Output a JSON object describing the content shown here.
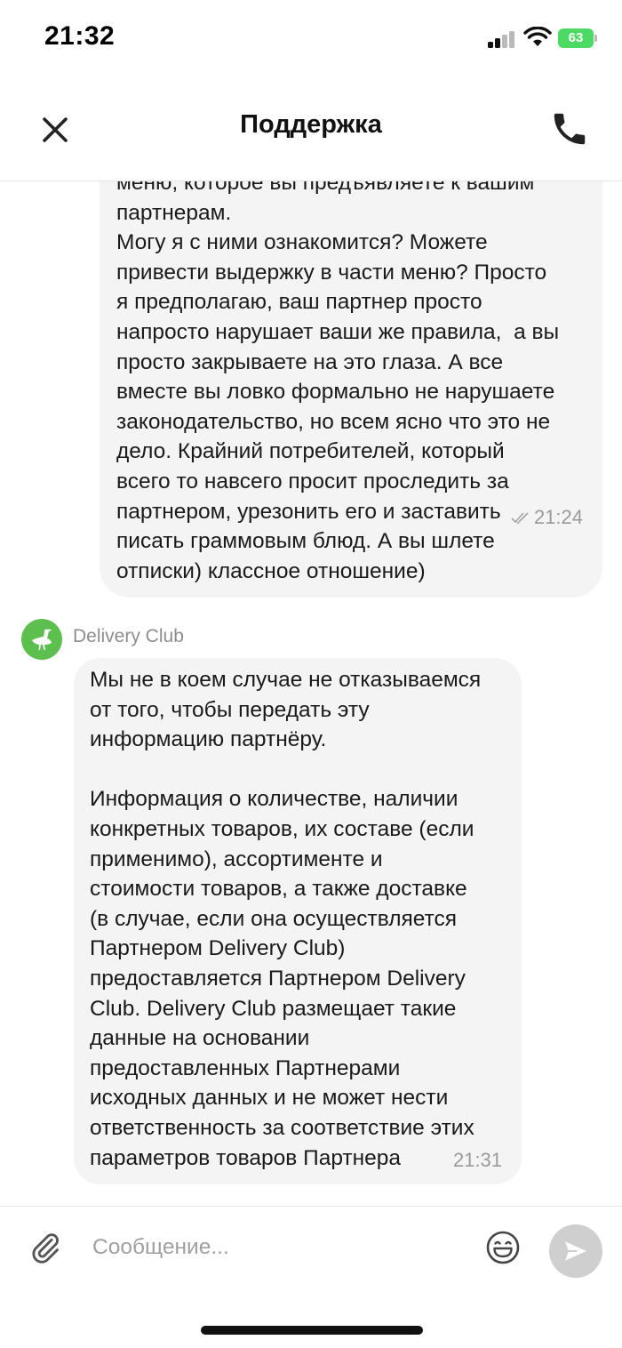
{
  "status_bar": {
    "time": "21:32",
    "battery": "63"
  },
  "header": {
    "title": "Поддержка",
    "close_icon": "close-icon",
    "call_icon": "phone-icon"
  },
  "chat": {
    "messages": [
      {
        "direction": "outgoing",
        "text": "меню, которое вы предъявляете к вашим\nпартнерам.\nМогу я с ними ознакомится? Можете\nпривести выдержку в части меню? Просто\nя предполагаю, ваш партнер просто\nнапросто нарушает ваши же правила,  а вы\nпросто закрываете на это глаза. А все\nвместе вы ловко формально не нарушаете\nзаконодательство, но всем ясно что это не\nдело. Крайний потребителей, который\nвсего то навсего просит проследить за\nпартнером, урезонить его и заставить\nписать граммовым блюд. А вы шлете\nотписки) классное отношение)",
        "time": "21:24",
        "status_icon": "double-check-icon"
      },
      {
        "direction": "incoming",
        "sender": "Delivery Club",
        "text": "Мы не в коем случае не отказываемся\nот того, чтобы передать эту\nинформацию партнёру.\n\nИнформация о количестве, наличии\nконкретных товаров, их составе (если\nприменимо), ассортименте и\nстоимости товаров, а также доставке\n(в случае, если она осуществляется\nПартнером Delivery Club)\nпредоставляется Партнером Delivery\nClub. Delivery Club размещает такие\nданные на основании\nпредоставленных Партнерами\nисходных данных и не может нести\nответственность за соответствие этих\nпараметров товаров Партнера",
        "time": "21:31"
      }
    ]
  },
  "composer": {
    "placeholder": "Сообщение...",
    "value": ""
  },
  "colors": {
    "bubble_bg": "#f4f4f4",
    "avatar_bg": "#5cbf4e",
    "battery": "#4cd964",
    "meta_text": "#9a9a9a",
    "send_button": "#cfcfcf"
  }
}
